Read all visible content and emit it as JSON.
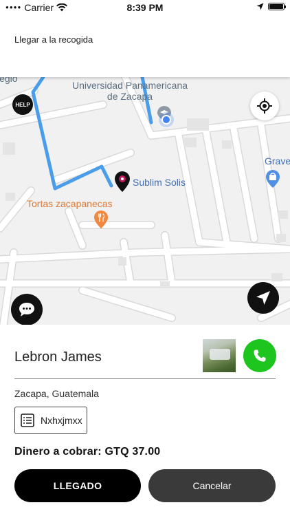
{
  "status_bar": {
    "carrier": "Carrier",
    "time": "8:39 PM"
  },
  "header": {
    "title": "Llegar a la recogida"
  },
  "map": {
    "labels": {
      "cut_left": "legio",
      "university": "Universidad Panamericana de Zacapa",
      "sublim": "Sublim Solis",
      "tortas": "Tortas zacapanecas",
      "grave": "Grave"
    },
    "help_label": "HELP",
    "colors": {
      "route": "#4a9de8",
      "user": "#4285f4",
      "food_pin": "#f0883e",
      "place_pin": "#4f8fe6"
    }
  },
  "trip": {
    "passenger_name": "Lebron James",
    "location": "Zacapa, Guatemala",
    "code": "Nxhxjmxx",
    "amount_label": "Dinero a cobrar:",
    "amount_value": "GTQ 37.00",
    "arrived_button": "LLEGADO",
    "cancel_button": "Cancelar"
  },
  "icons": [
    "wifi-icon",
    "location-arrow-icon",
    "battery-icon",
    "help-icon",
    "locate-icon",
    "chat-icon",
    "navigation-icon",
    "phone-icon",
    "list-icon"
  ],
  "colors": {
    "call_button": "#1ec51e",
    "primary_button": "#000000",
    "secondary_button": "#3a3a3a"
  }
}
